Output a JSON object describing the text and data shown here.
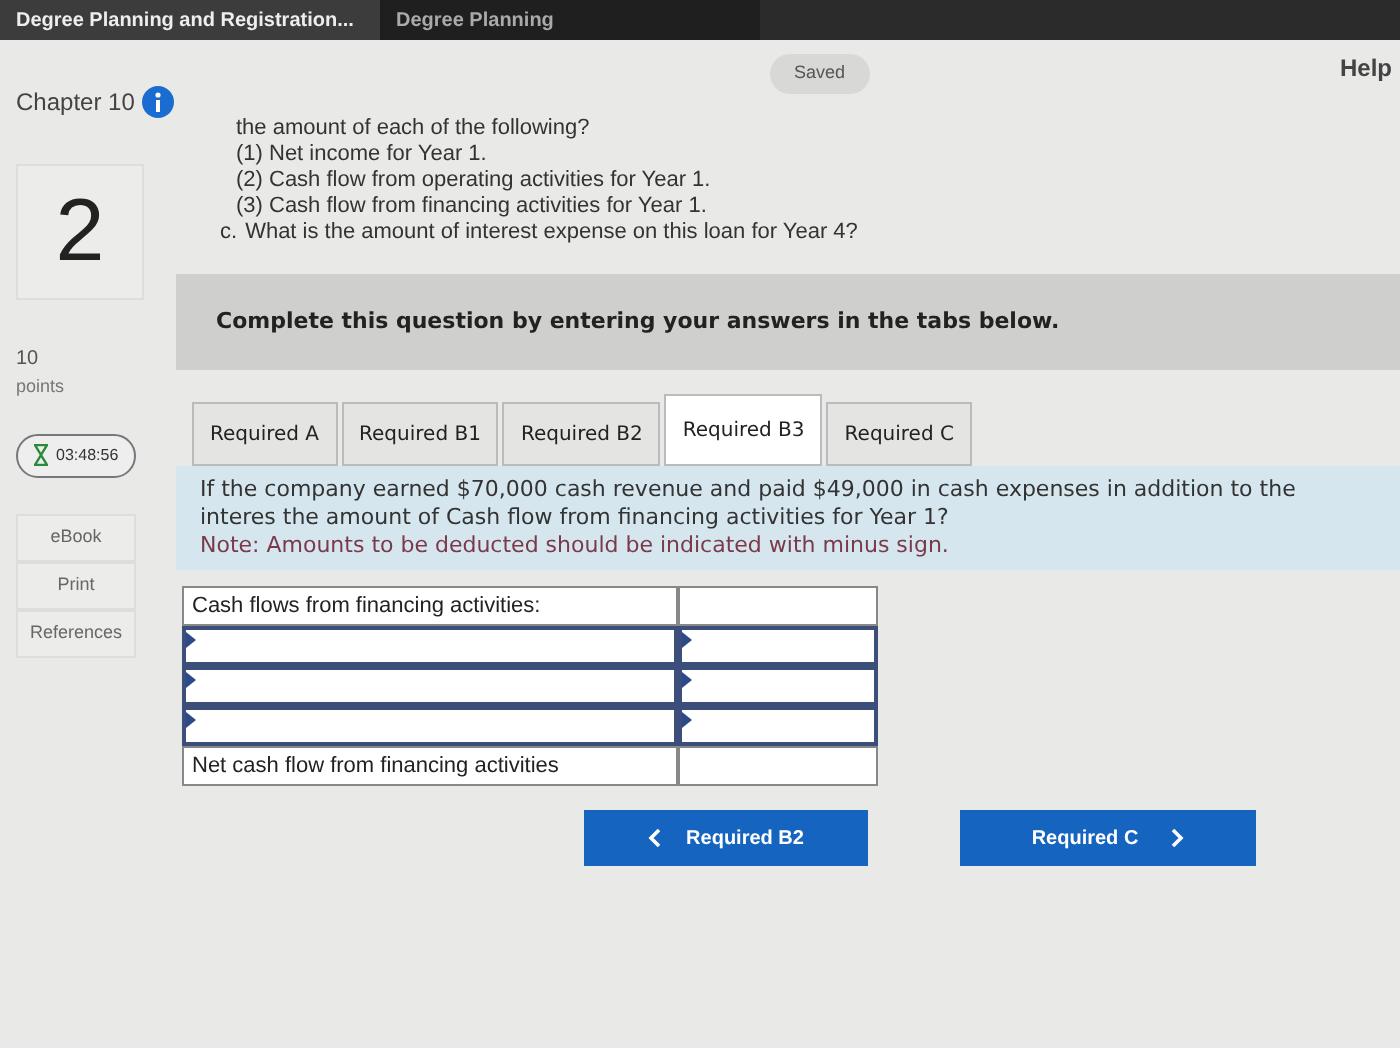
{
  "browser_tabs": [
    {
      "label": "Degree Planning and Registration...",
      "selected": true
    },
    {
      "label": "Degree Planning",
      "selected": false
    }
  ],
  "header": {
    "status": "Saved",
    "help": "Help"
  },
  "sidebar": {
    "chapter": "Chapter 10",
    "question_number": "2",
    "points_value": "10",
    "points_label": "points",
    "timer": "03:48:56",
    "links": [
      "eBook",
      "Print",
      "References"
    ]
  },
  "question_lines": [
    {
      "kind": "line",
      "text": "the amount of each of the following?"
    },
    {
      "kind": "sub",
      "text": "(1) Net income for Year 1."
    },
    {
      "kind": "sub",
      "text": "(2) Cash flow from operating activities for Year 1."
    },
    {
      "kind": "sub",
      "text": "(3) Cash flow from financing activities for Year 1."
    },
    {
      "kind": "item",
      "marker": "c.",
      "text": "What is the amount of interest expense on this loan for Year 4?"
    }
  ],
  "instruction": "Complete this question by entering your answers in the tabs below.",
  "tabs": [
    {
      "label": "Required A",
      "selected": false
    },
    {
      "label": "Required B1",
      "selected": false
    },
    {
      "label": "Required B2",
      "selected": false
    },
    {
      "label": "Required B3",
      "selected": true
    },
    {
      "label": "Required C",
      "selected": false
    }
  ],
  "prompt": "If the company earned $70,000 cash revenue and paid $49,000 in cash expenses in addition to the interes the amount of Cash flow from financing activities for Year 1?",
  "note": "Note: Amounts to be deducted should be indicated with minus sign.",
  "table_rows": [
    {
      "kind": "label",
      "label": "Cash flows from financing activities:"
    },
    {
      "kind": "input"
    },
    {
      "kind": "input"
    },
    {
      "kind": "input"
    },
    {
      "kind": "total",
      "label": "Net cash flow from financing activities"
    }
  ],
  "nav_buttons": [
    {
      "kind": "prev",
      "label": "Required B2"
    },
    {
      "kind": "next",
      "label": "Required C"
    }
  ]
}
